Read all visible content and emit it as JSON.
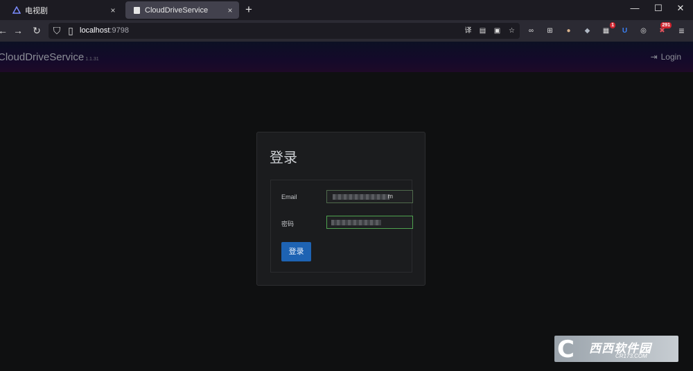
{
  "browser": {
    "tabs": [
      {
        "label": "电视剧",
        "icon": "triangle-logo-icon",
        "active": false
      },
      {
        "label": "CloudDriveService",
        "icon": "page-icon",
        "active": true
      }
    ],
    "close_glyph": "×",
    "new_tab_glyph": "+",
    "window_controls": {
      "minimize": "—",
      "maximize": "☐",
      "close": "✕"
    },
    "nav": {
      "back": "←",
      "forward": "→",
      "reload": "↻",
      "shield": "⛉",
      "page": "▯"
    },
    "url": {
      "host": "localhost",
      "port": ":9798"
    },
    "extensions": [
      {
        "name": "translate-icon",
        "glyph": "译"
      },
      {
        "name": "reader-icon",
        "glyph": "▤"
      },
      {
        "name": "screenshot-icon",
        "glyph": "▣"
      },
      {
        "name": "bookmark-star-icon",
        "glyph": "☆"
      },
      {
        "name": "infinity-icon",
        "glyph": "∞"
      },
      {
        "name": "grid-ext-icon",
        "glyph": "⊞"
      },
      {
        "name": "avatar-ext-icon",
        "glyph": "●"
      },
      {
        "name": "ninja-ext-icon",
        "glyph": "◆"
      },
      {
        "name": "badge-ext-icon",
        "glyph": "▦",
        "badge": "1"
      },
      {
        "name": "magnet-ext-icon",
        "glyph": "U"
      },
      {
        "name": "circle-ext-icon",
        "glyph": "◎"
      },
      {
        "name": "ublock-ext-icon",
        "glyph": "✖",
        "badge": "291"
      },
      {
        "name": "menu-icon",
        "glyph": "≡"
      }
    ]
  },
  "app": {
    "brand": "CloudDriveService",
    "version": "1.1.31",
    "login_label": "Login",
    "login_glyph": "⇥"
  },
  "login_card": {
    "title": "登录",
    "email_label": "Email",
    "email_value_tail": "m",
    "password_label": "密码",
    "submit_label": "登录"
  },
  "watermark": {
    "mark": "C",
    "text": "西西软件园",
    "site": "CR173.COM"
  },
  "colors": {
    "accent_button": "#1e63b3",
    "focus_border": "#4fa34f",
    "page_bg": "#0f1011"
  }
}
